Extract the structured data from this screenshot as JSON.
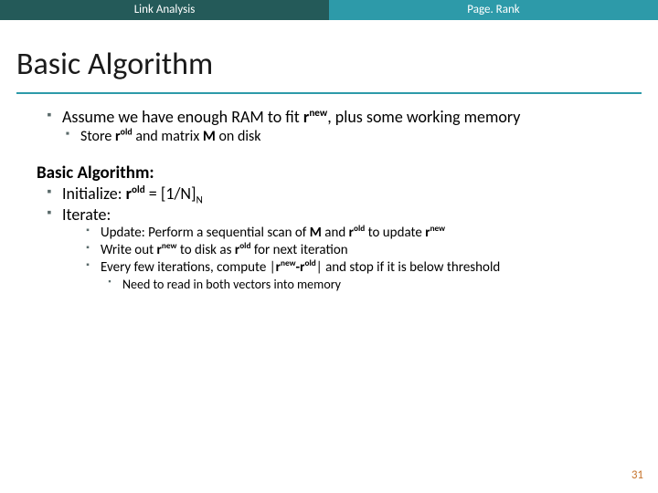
{
  "header": {
    "left_tab": "Link Analysis",
    "right_tab": "Page. Rank"
  },
  "title": "Basic Algorithm",
  "main": {
    "point1_pre": "Assume we have enough RAM to fit ",
    "point1_bold": "r",
    "point1_sup": "new",
    "point1_post": ", plus some working memory",
    "sub1_a": "Store ",
    "sub1_b": "r",
    "sub1_sup": "old",
    "sub1_c": " and matrix ",
    "sub1_d": "M",
    "sub1_e": " on disk"
  },
  "algo": {
    "heading": "Basic Algorithm:",
    "init_a": "Initialize: ",
    "init_b": "r",
    "init_sup": "old",
    "init_c": " = [1/N]",
    "init_sub": "N",
    "iterate": "Iterate:",
    "u_a": "Update: Perform a sequential scan of ",
    "u_b": "M",
    "u_c": " and ",
    "u_d": "r",
    "u_sup1": "old",
    "u_e": " to update ",
    "u_f": "r",
    "u_sup2": "new",
    "w_a": "Write out ",
    "w_b": "r",
    "w_sup1": "new",
    "w_c": " to disk as ",
    "w_d": "r",
    "w_sup2": "old",
    "w_e": " for next iteration",
    "c_a": "Every few iterations, compute |",
    "c_b": "r",
    "c_sup1": "new",
    "c_dash": "-",
    "c_d": "r",
    "c_sup2": "old",
    "c_e": "| and stop if it is below threshold",
    "need": "Need to read in both vectors into memory"
  },
  "page_number": "31"
}
